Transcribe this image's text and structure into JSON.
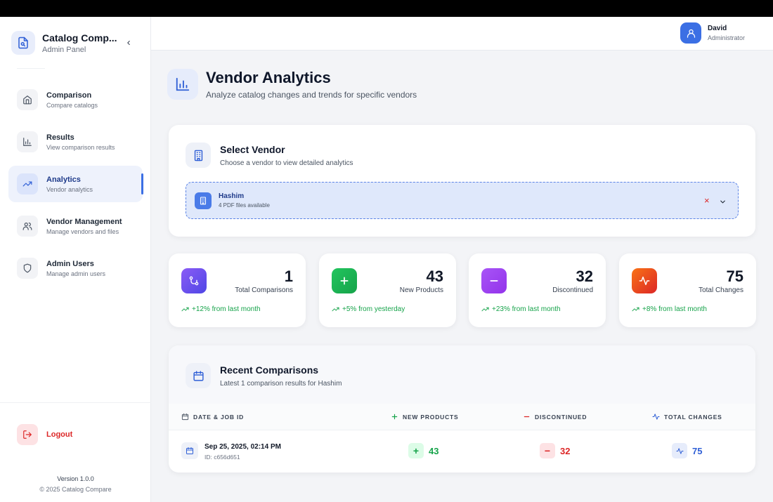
{
  "app": {
    "title": "Catalog Comp...",
    "subtitle": "Admin Panel"
  },
  "sidebar": {
    "items": [
      {
        "label": "Comparison",
        "sub": "Compare catalogs",
        "icon": "home-icon",
        "active": false
      },
      {
        "label": "Results",
        "sub": "View comparison results",
        "icon": "bar-chart-icon",
        "active": false
      },
      {
        "label": "Analytics",
        "sub": "Vendor analytics",
        "icon": "trending-up-icon",
        "active": true
      },
      {
        "label": "Vendor Management",
        "sub": "Manage vendors and files",
        "icon": "users-icon",
        "active": false
      },
      {
        "label": "Admin Users",
        "sub": "Manage admin users",
        "icon": "shield-icon",
        "active": false
      }
    ],
    "logout": "Logout",
    "version": "Version 1.0.0",
    "copyright": "© 2025 Catalog Compare"
  },
  "user": {
    "name": "David",
    "role": "Administrator"
  },
  "page": {
    "title": "Vendor Analytics",
    "subtitle": "Analyze catalog changes and trends for specific vendors"
  },
  "vendor_section": {
    "title": "Select Vendor",
    "subtitle": "Choose a vendor to view detailed analytics",
    "selected": {
      "name": "Hashim",
      "files": "4 PDF files available"
    },
    "clear": "×"
  },
  "stats": [
    {
      "value": "1",
      "label": "Total Comparisons",
      "trend": "+12% from last month",
      "color": "#7c3aed"
    },
    {
      "value": "43",
      "label": "New Products",
      "trend": "+5% from yesterday",
      "color": "#16a34a"
    },
    {
      "value": "32",
      "label": "Discontinued",
      "trend": "+23% from last month",
      "color": "#9333ea"
    },
    {
      "value": "75",
      "label": "Total Changes",
      "trend": "+8% from last month",
      "color": "#ea580c"
    }
  ],
  "recent": {
    "title": "Recent Comparisons",
    "subtitle": "Latest 1 comparison results for Hashim",
    "columns": [
      "DATE & JOB ID",
      "NEW PRODUCTS",
      "DISCONTINUED",
      "TOTAL CHANGES"
    ],
    "rows": [
      {
        "date": "Sep 25, 2025, 02:14 PM",
        "job_id": "ID: c656d651",
        "new_products": "43",
        "discontinued": "32",
        "total_changes": "75"
      }
    ],
    "badges": {
      "plus": "+",
      "minus": "−"
    }
  }
}
